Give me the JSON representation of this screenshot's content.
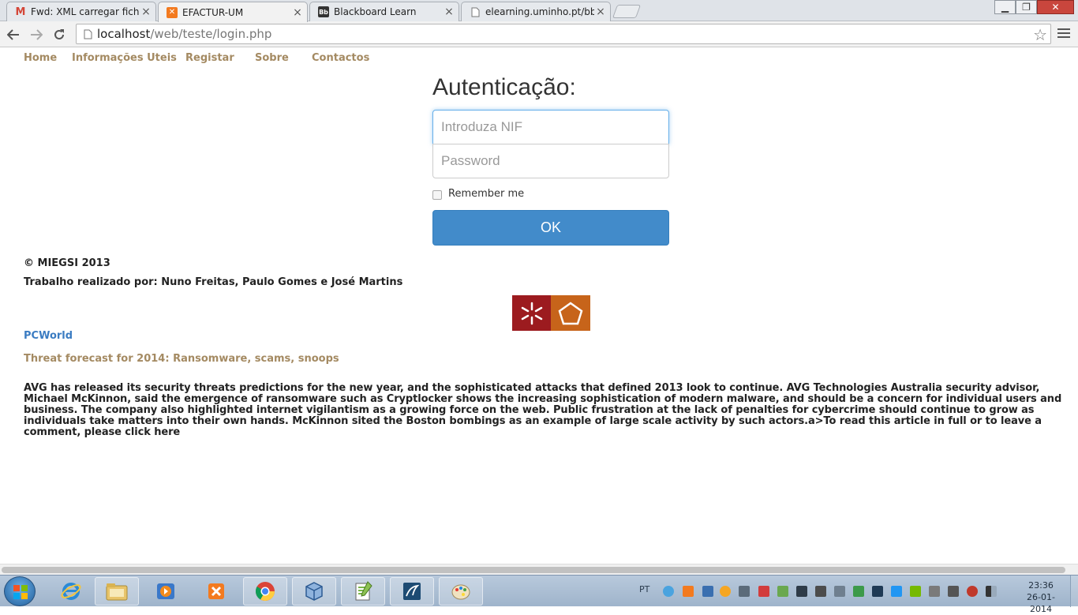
{
  "browser": {
    "tabs": [
      {
        "label": "Fwd: XML carregar ficheiro",
        "icon": "gmail-icon",
        "active": false
      },
      {
        "label": "EFACTUR-UM",
        "icon": "xampp-icon",
        "active": true
      },
      {
        "label": "Blackboard Learn",
        "icon": "blackboard-icon",
        "active": false
      },
      {
        "label": "elearning.uminho.pt/bbcsw",
        "icon": "page-icon",
        "active": false
      }
    ],
    "tab_close_glyph": "×",
    "address": {
      "host": "localhost",
      "path": "/web/teste/login.php"
    },
    "window_controls": {
      "minimize": "▁",
      "maximize": "❐",
      "close": "✕"
    }
  },
  "nav": {
    "items": [
      "Home",
      "Informações Uteis",
      "Registar",
      "Sobre",
      "Contactos"
    ]
  },
  "login": {
    "heading": "Autenticação:",
    "nif_placeholder": "Introduza NIF",
    "password_placeholder": "Password",
    "remember_label": "Remember me",
    "submit_label": "OK"
  },
  "footer": {
    "copyright": "© MIEGSI 2013",
    "credits": "Trabalho realizado por: Nuno Freitas, Paulo Gomes e José Martins"
  },
  "feed": {
    "source": "PCWorld",
    "title": "Threat forecast for 2014: Ransomware, scams, snoops",
    "body": "AVG has released its security threats predictions for the new year, and the sophisticated attacks that defined 2013 look to continue. AVG Technologies Australia security advisor, Michael McKinnon, said the emergence of ransomware such as Cryptlocker shows the increasing sophistication of modern malware, and should be a concern for individual users and business. The company also highlighted internet vigilantism as a growing force on the web. Public frustration at the lack of penalties for cybercrime should continue to grow as individuals take matters into their own hands. McKinnon sited the Boston bombings as an example of large scale activity by such actors.a>To read this article in full or to leave a comment, please click here"
  },
  "taskbar": {
    "apps": [
      "internet-explorer-icon",
      "file-explorer-icon",
      "media-player-icon",
      "xampp-control-icon",
      "chrome-icon",
      "virtualbox-icon",
      "notepad-plus-plus-icon",
      "mysql-workbench-icon",
      "paint-icon"
    ],
    "language": "PT",
    "time": "23:36",
    "date": "26-01-2014"
  },
  "colors": {
    "nav_link": "#a48a62",
    "primary_button": "#428bca",
    "feed_source": "#3b7cc2",
    "uminho_red": "#9c1b1f",
    "uminho_orange": "#c7641a"
  }
}
